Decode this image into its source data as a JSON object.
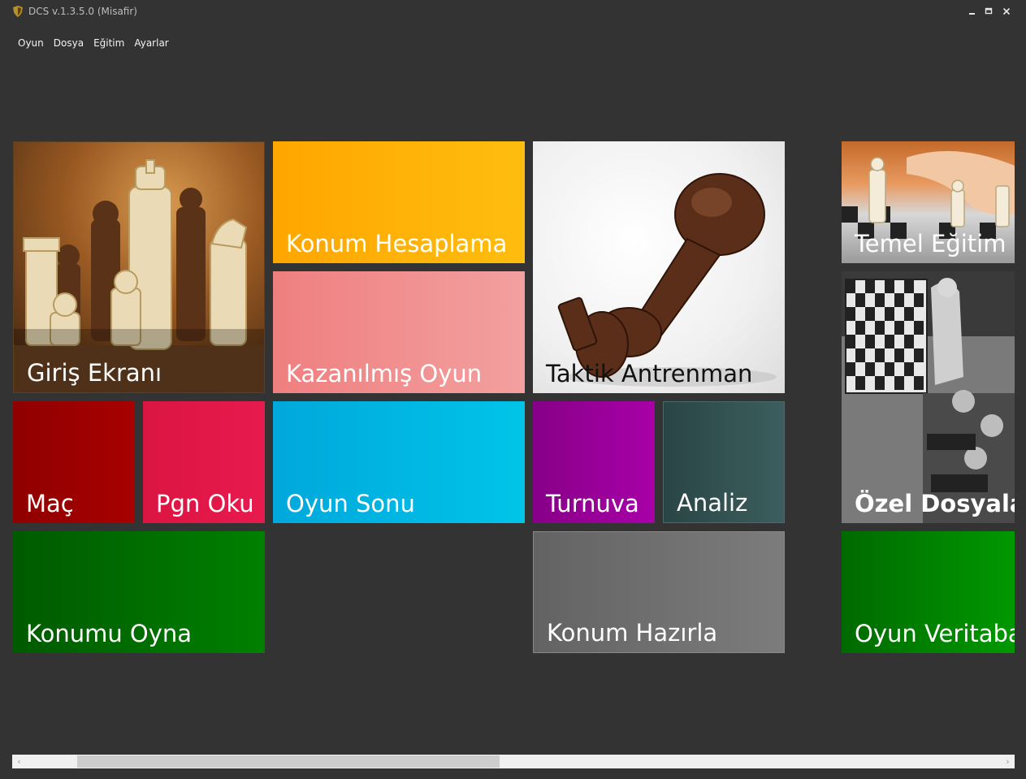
{
  "window": {
    "title": "DCS v.1.3.5.0 (Misafir)",
    "icon": "shield-logo-icon",
    "controls": {
      "minimize": "▁",
      "maximize": "□",
      "close": "✕"
    }
  },
  "menu": {
    "items": [
      {
        "label": "Oyun"
      },
      {
        "label": "Dosya"
      },
      {
        "label": "Eğitim"
      },
      {
        "label": "Ayarlar"
      }
    ]
  },
  "tiles": {
    "giris_ekrani": {
      "label": "Giriş Ekranı",
      "image": "chess-pieces-photo"
    },
    "konum_hesaplama": {
      "label": "Konum Hesaplama",
      "color": "#ffa800"
    },
    "kazanilmis_oyun": {
      "label": "Kazanılmış Oyun",
      "color": "#f08080"
    },
    "taktik_antrenman": {
      "label": "Taktik Antrenman",
      "image": "fallen-king-photo"
    },
    "temel_egitim": {
      "label": "Temel Eğitim",
      "image": "hand-moving-piece-photo"
    },
    "ozel_dosyalar": {
      "label": "Özel Dosyalar",
      "image": "vintage-demo-board-photo"
    },
    "mac": {
      "label": "Maç",
      "color": "#9b0000"
    },
    "pgn_oku": {
      "label": "Pgn Oku",
      "color": "#e0174a"
    },
    "oyun_sonu": {
      "label": "Oyun Sonu",
      "color": "#00b4e0"
    },
    "turnuva": {
      "label": "Turnuva",
      "color": "#9b009b"
    },
    "analiz": {
      "label": "Analiz",
      "color": "#3a5858"
    },
    "konumu_oyna": {
      "label": "Konumu Oyna",
      "color": "#006b00"
    },
    "konum_hazirla": {
      "label": "Konum Hazırla",
      "color": "#6e6e6e"
    },
    "oyun_veritabani": {
      "label": "Oyun Veritabanı",
      "color": "#008a00"
    }
  },
  "scrollbar": {
    "left_arrow": "‹",
    "right_arrow": "›"
  }
}
